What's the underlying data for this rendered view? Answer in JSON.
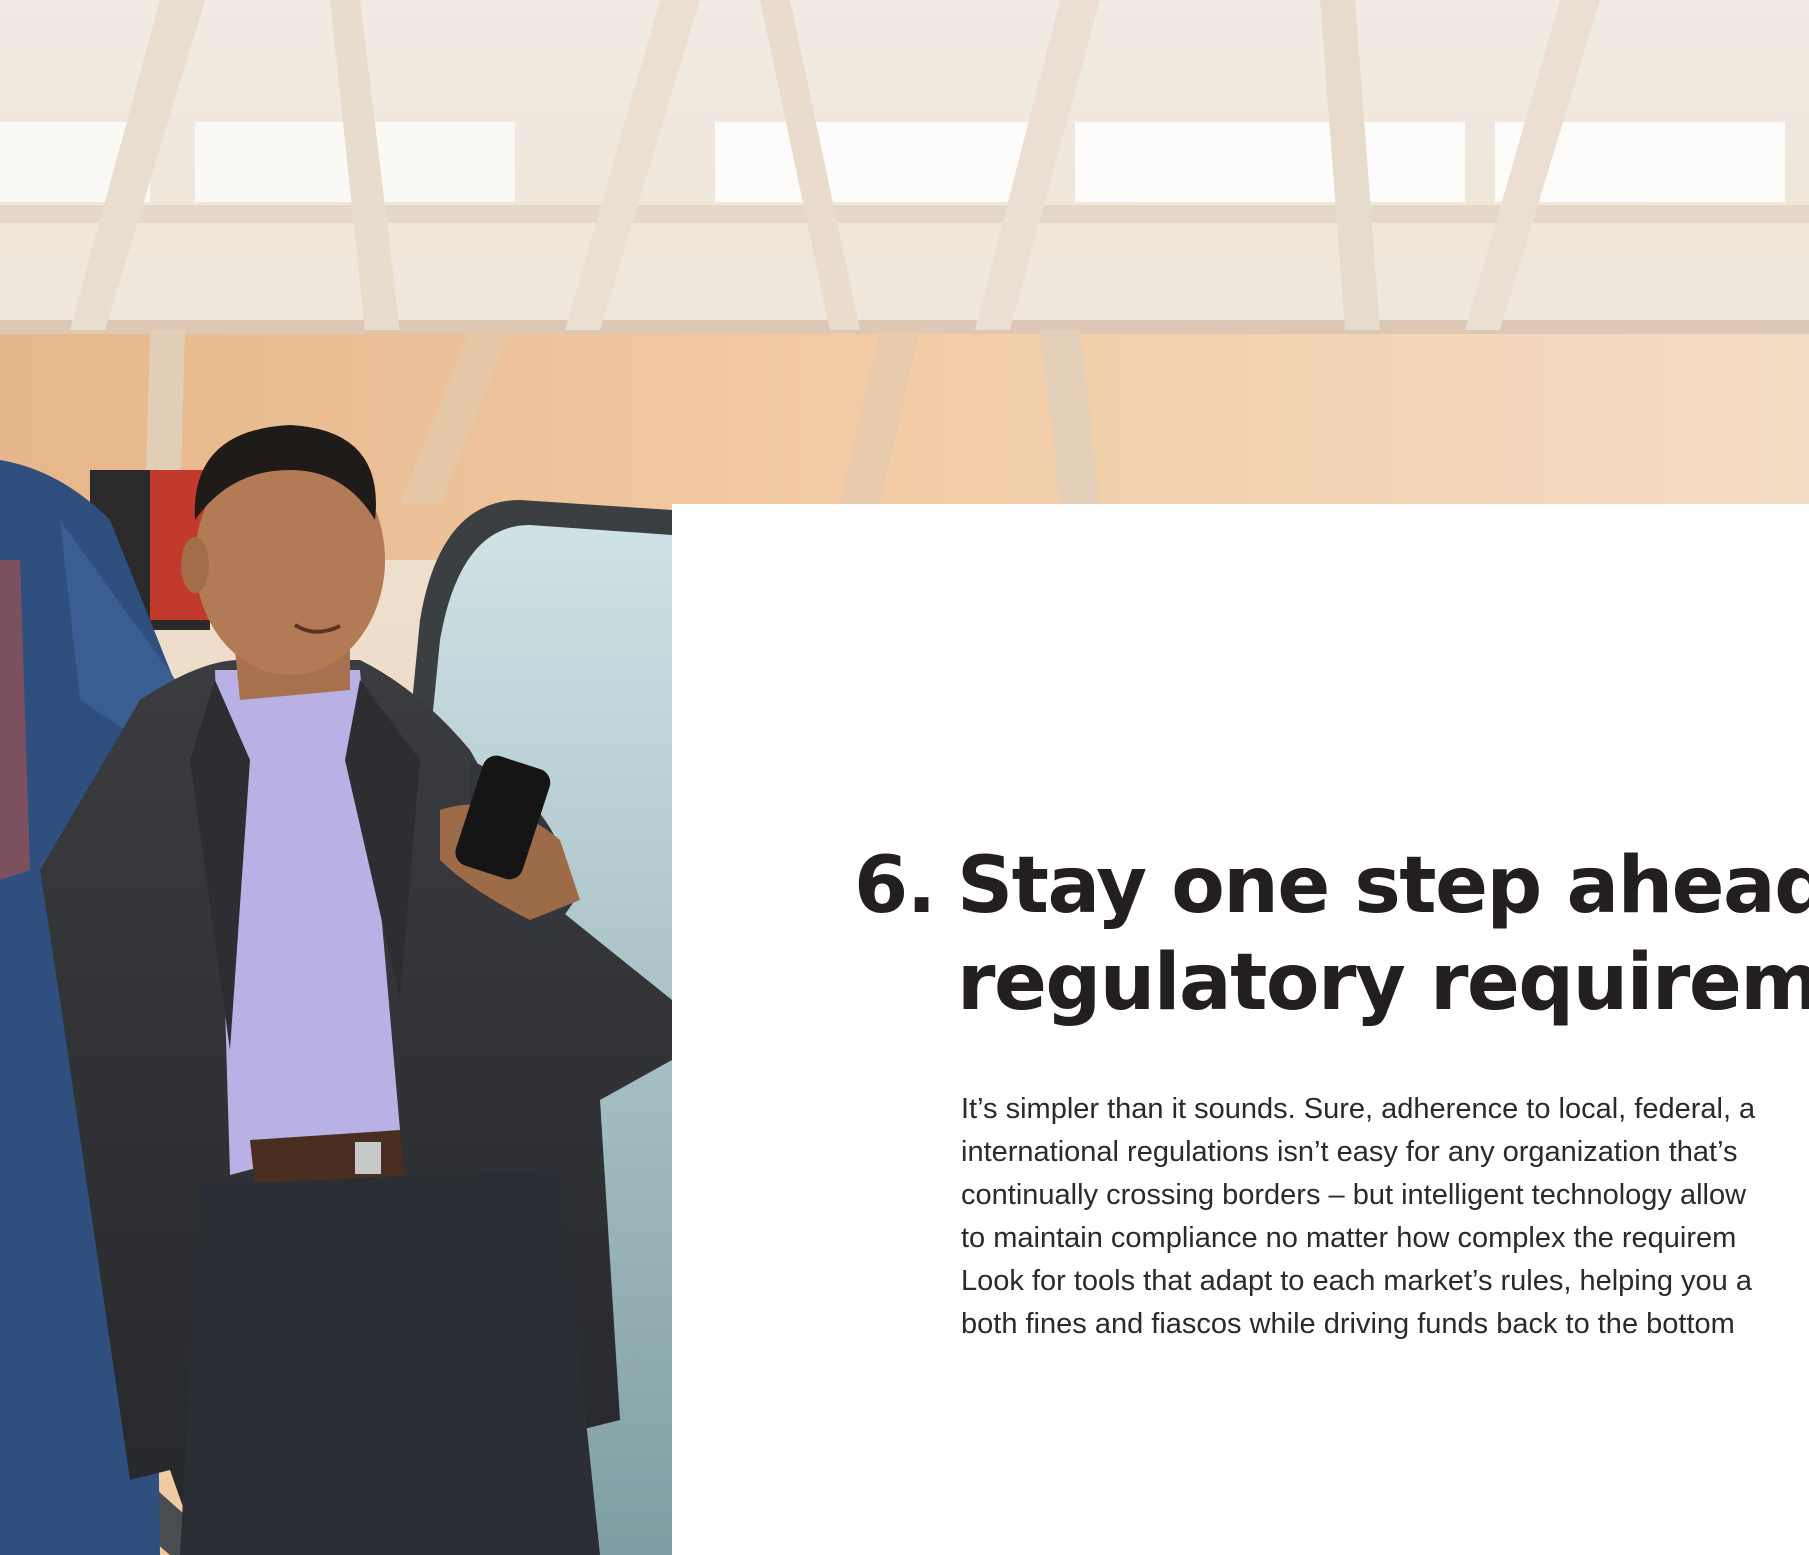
{
  "article": {
    "number": "6.",
    "heading_line1": "Stay one step ahead o",
    "heading_line2": "regulatory requiremer",
    "body_lines": [
      "It’s simpler than it sounds. Sure, adherence to local, federal, a",
      "international regulations isn’t easy for any organization that’s",
      "continually crossing borders – but intelligent technology allow",
      "to maintain compliance no matter how complex the requirem",
      "Look for tools that adapt to each market’s rules, helping you a",
      "both fines and fiascos while driving funds back to the bottom"
    ]
  },
  "colors": {
    "heading": "#231f20",
    "body": "#2a2a2a",
    "card": "#ffffff"
  }
}
